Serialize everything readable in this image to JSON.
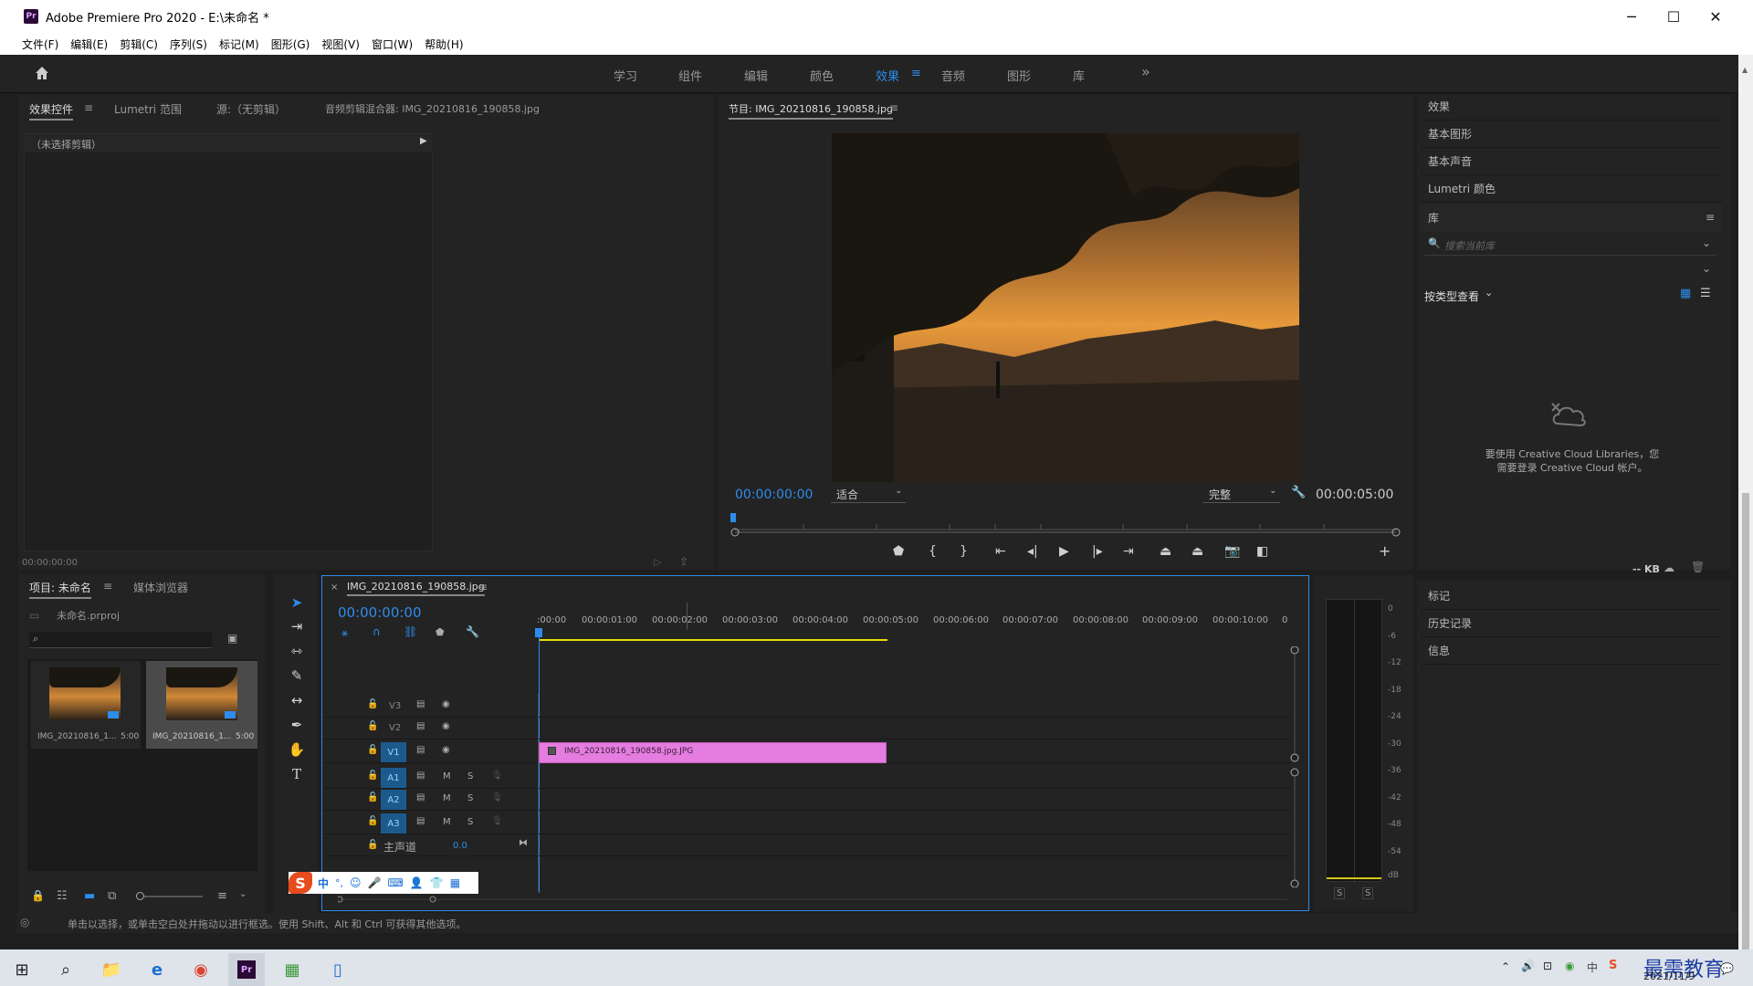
{
  "window": {
    "title": "Adobe Premiere Pro 2020 - E:\\未命名 *",
    "logo": "Pr",
    "minimize": "─",
    "maximize": "☐",
    "close": "✕"
  },
  "menu": [
    "文件(F)",
    "编辑(E)",
    "剪辑(C)",
    "序列(S)",
    "标记(M)",
    "图形(G)",
    "视图(V)",
    "窗口(W)",
    "帮助(H)"
  ],
  "workspaces": {
    "items": [
      "学习",
      "组件",
      "编辑",
      "颜色",
      "效果",
      "音频",
      "图形",
      "库"
    ],
    "active": "效果",
    "more": "»"
  },
  "source_panel": {
    "tabs": [
      "效果控件",
      "Lumetri 范围",
      "源:（无剪辑）",
      "音频剪辑混合器: IMG_20210816_190858.jpg"
    ],
    "no_clip": "（未选择剪辑）",
    "timecode": "00:00:00:00"
  },
  "program": {
    "title": "节目: IMG_20210816_190858.jpg",
    "timecode": "00:00:00:00",
    "fit": "适合",
    "quality": "完整",
    "duration": "00:00:05:00"
  },
  "right_panel": {
    "items": [
      "效果",
      "基本图形",
      "基本声音",
      "Lumetri 颜色"
    ],
    "library": "库",
    "search_placeholder": "搜索当前库",
    "view_by": "按类型查看",
    "cc_msg1": "要使用 Creative Cloud Libraries，您",
    "cc_msg2": "需要登录 Creative Cloud 帐户。",
    "kb": "-- KB",
    "bottom_items": [
      "标记",
      "历史记录",
      "信息"
    ]
  },
  "project": {
    "tabs": [
      "项目: 未命名",
      "媒体浏览器"
    ],
    "file": "未命名.prproj",
    "items": [
      {
        "name": "IMG_20210816_1...",
        "dur": "5:00"
      },
      {
        "name": "IMG_20210816_1...",
        "dur": "5:00"
      }
    ]
  },
  "timeline": {
    "tab": "IMG_20210816_190858.jpg",
    "timecode": "00:00:00:00",
    "ruler": [
      ":00:00",
      "00:00:01:00",
      "00:00:02:00",
      "00:00:03:00",
      "00:00:04:00",
      "00:00:05:00",
      "00:00:06:00",
      "00:00:07:00",
      "00:00:08:00",
      "00:00:09:00",
      "00:00:10:00",
      "0"
    ],
    "video_tracks": [
      "V3",
      "V2",
      "V1"
    ],
    "audio_tracks": [
      "A1",
      "A2",
      "A3"
    ],
    "master": "主声道",
    "master_val": "0.0",
    "clip": "IMG_20210816_190858.jpg.JPG",
    "m": "M",
    "s": "S"
  },
  "meter": {
    "labels": [
      "0",
      "-6",
      "-12",
      "-18",
      "-24",
      "-30",
      "-36",
      "-42",
      "-48",
      "-54",
      "dB"
    ],
    "solo": [
      "S",
      "S"
    ]
  },
  "status": "单击以选择，或单击空白处并拖动以进行框选。使用 Shift、Alt 和 Ctrl 可获得其他选项。",
  "ime": {
    "items": [
      "中",
      "°,",
      "☺",
      "🎤",
      "⌨",
      "👤",
      "👕",
      "▦"
    ]
  },
  "taskbar": {
    "date": "2021/11/9",
    "watermark": "最需教育",
    "input": "中"
  },
  "colors": {
    "accent": "#2d8ceb",
    "clip": "#e47ddf",
    "panel": "#232323",
    "bg": "#1e1e1e"
  }
}
